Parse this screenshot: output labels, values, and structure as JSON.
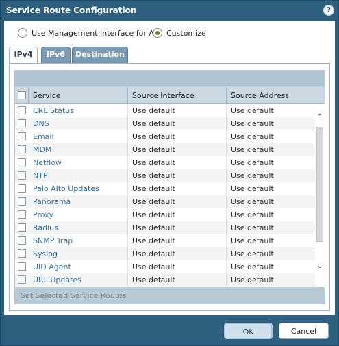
{
  "dialog": {
    "title": "Service Route Configuration",
    "help_icon": "question-mark-circle-icon",
    "help_label": "?"
  },
  "mode": {
    "options": [
      {
        "label": "Use Management Interface for All",
        "selected": false
      },
      {
        "label": "Customize",
        "selected": true
      }
    ]
  },
  "tabs": [
    {
      "label": "IPv4",
      "active": true
    },
    {
      "label": "IPv6",
      "active": false
    },
    {
      "label": "Destination",
      "active": false
    }
  ],
  "table": {
    "columns": [
      "Service",
      "Source Interface",
      "Source Address"
    ],
    "rows": [
      {
        "service": "CRL Status",
        "interface": "Use default",
        "address": "Use default"
      },
      {
        "service": "DNS",
        "interface": "Use default",
        "address": "Use default"
      },
      {
        "service": "Email",
        "interface": "Use default",
        "address": "Use default"
      },
      {
        "service": "MDM",
        "interface": "Use default",
        "address": "Use default"
      },
      {
        "service": "Netflow",
        "interface": "Use default",
        "address": "Use default"
      },
      {
        "service": "NTP",
        "interface": "Use default",
        "address": "Use default"
      },
      {
        "service": "Palo Alto Updates",
        "interface": "Use default",
        "address": "Use default"
      },
      {
        "service": "Panorama",
        "interface": "Use default",
        "address": "Use default"
      },
      {
        "service": "Proxy",
        "interface": "Use default",
        "address": "Use default"
      },
      {
        "service": "Radius",
        "interface": "Use default",
        "address": "Use default"
      },
      {
        "service": "SNMP Trap",
        "interface": "Use default",
        "address": "Use default"
      },
      {
        "service": "Syslog",
        "interface": "Use default",
        "address": "Use default"
      },
      {
        "service": "UID Agent",
        "interface": "Use default",
        "address": "Use default"
      },
      {
        "service": "URL Updates",
        "interface": "Use default",
        "address": "Use default"
      }
    ],
    "footer_action": "Set Selected Service Routes"
  },
  "buttons": {
    "ok": "OK",
    "cancel": "Cancel"
  }
}
